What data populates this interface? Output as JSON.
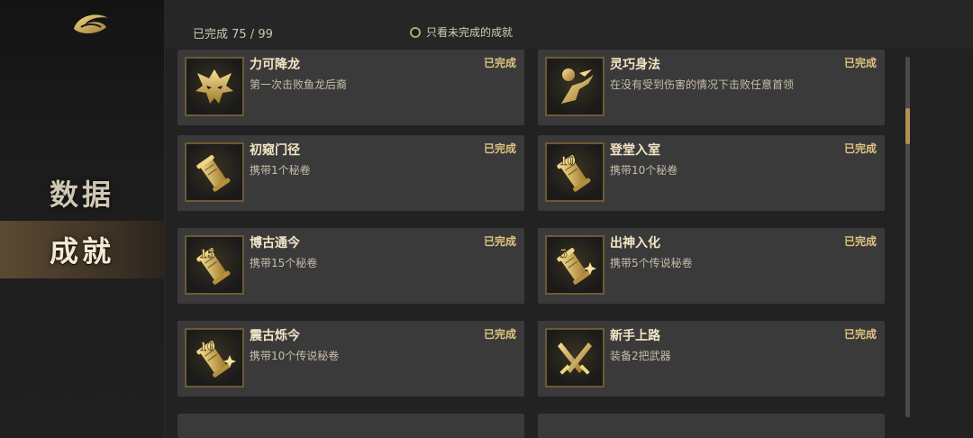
{
  "sidebar": {
    "logo_icon": "dragon-swirl-logo",
    "items": [
      {
        "label": "数据"
      },
      {
        "label": "成就"
      }
    ],
    "active_bg": "#5b4a33"
  },
  "header": {
    "progress": "已完成 75 / 99",
    "filter_label": "只看未完成的成就"
  },
  "achievements": [
    {
      "title": "力可降龙",
      "desc": "第一次击败鱼龙后裔",
      "status": "已完成",
      "icon": "dragon-mask-icon"
    },
    {
      "title": "灵巧身法",
      "desc": "在没有受到伤害的情况下击败任意首领",
      "status": "已完成",
      "icon": "dodge-figure-icon"
    },
    {
      "title": "初窥门径",
      "desc": "携带1个秘卷",
      "status": "已完成",
      "icon": "scroll-icon"
    },
    {
      "title": "登堂入室",
      "desc": "携带10个秘卷",
      "status": "已完成",
      "icon": "scroll-10-icon",
      "badge": "10"
    },
    {
      "title": "博古通今",
      "desc": "携带15个秘卷",
      "status": "已完成",
      "icon": "scroll-15-icon",
      "badge": "15"
    },
    {
      "title": "出神入化",
      "desc": "携带5个传说秘卷",
      "status": "已完成",
      "icon": "legend-scroll-5-icon",
      "badge": "5"
    },
    {
      "title": "震古烁今",
      "desc": "携带10个传说秘卷",
      "status": "已完成",
      "icon": "legend-scroll-10-icon",
      "badge": "10"
    },
    {
      "title": "新手上路",
      "desc": "装备2把武器",
      "status": "已完成",
      "icon": "crossed-swords-icon"
    }
  ],
  "colors": {
    "gold": "#d9b85a",
    "status": "#e0c47f",
    "card_bg": "#3a3a3a"
  }
}
